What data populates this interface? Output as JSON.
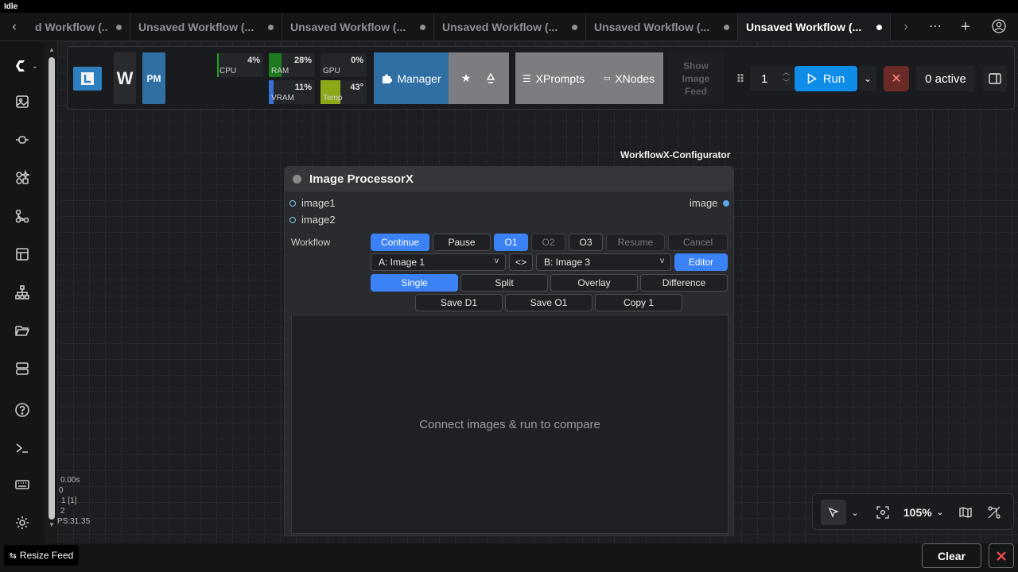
{
  "window": {
    "title": "Idle"
  },
  "tabs": [
    {
      "label": "d Workflow (...",
      "active": false
    },
    {
      "label": "Unsaved Workflow (...",
      "active": false
    },
    {
      "label": "Unsaved Workflow (...",
      "active": false
    },
    {
      "label": "Unsaved Workflow (...",
      "active": false
    },
    {
      "label": "Unsaved Workflow (...",
      "active": false
    },
    {
      "label": "Unsaved Workflow (...",
      "active": true
    }
  ],
  "toolbar": {
    "w_label": "W",
    "pm_label": "PM",
    "metrics": [
      {
        "label": "CPU",
        "value": "4%",
        "level": 0.04,
        "color": "#22a022"
      },
      {
        "label": "RAM",
        "value": "28%",
        "level": 0.28,
        "color": "#1e7a1e"
      },
      {
        "label": "GPU",
        "value": "0%",
        "level": 0.0,
        "color": "#22a022"
      },
      {
        "label": "VRAM",
        "value": "11%",
        "level": 0.11,
        "color": "#3b6fd6"
      },
      {
        "label": "Temp",
        "value": "43°",
        "level": 0.43,
        "color": "#8aa818"
      }
    ],
    "manager_label": "Manager",
    "xprompts_label": "XPrompts",
    "xnodes_label": "XNodes",
    "show_image_feed_label": "Show Image Feed",
    "queue_count": "1",
    "run_label": "Run",
    "active_label": "0 active"
  },
  "node": {
    "group_label": "WorkflowX-Configurator",
    "title": "Image ProcessorX",
    "inputs": [
      "image1",
      "image2"
    ],
    "output": "image",
    "workflow_label": "Workflow",
    "row1": [
      "Continue",
      "Pause",
      "O1",
      "O2",
      "O3",
      "Resume",
      "Cancel"
    ],
    "select_a": "A: Image 1",
    "select_a_chev": "v",
    "swap_label": "<>",
    "select_b": "B: Image 3",
    "select_b_chev": "v",
    "editor_label": "Editor",
    "modes": [
      "Single",
      "Split",
      "Overlay",
      "Difference"
    ],
    "actions": [
      "Save D1",
      "Save O1",
      "Copy 1"
    ],
    "preview_text": "Connect images & run to compare"
  },
  "stats": [
    "0.00s",
    "0",
    "1 [1]",
    "2",
    "PS:31.35"
  ],
  "zoom": {
    "level": "105%"
  },
  "bottom": {
    "resize_feed_label": "Resize Feed",
    "clear_label": "Clear"
  },
  "colors": {
    "accent_blue": "#3b82f6",
    "run_blue": "#0e8de8",
    "manager_blue": "#2f6fa3",
    "cancel_red": "#6b2a28"
  }
}
